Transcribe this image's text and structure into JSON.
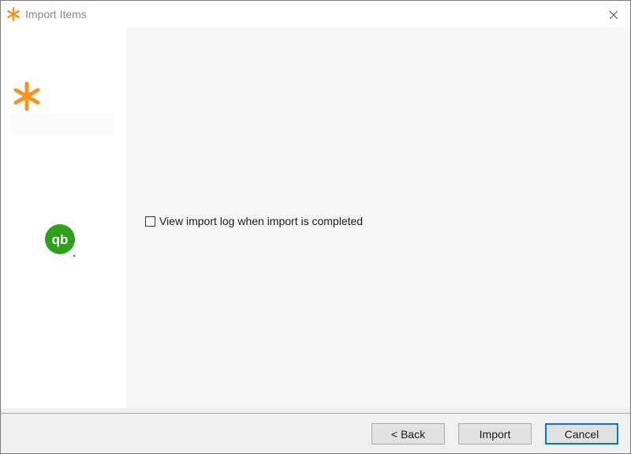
{
  "window": {
    "title": "Import Items",
    "icon": "asterisk-logo-icon",
    "close_icon": "close-icon"
  },
  "sidebar": {
    "brand_icon": "orange-asterisk-logo-icon",
    "integration_icon": "quickbooks-logo-icon",
    "integration_icon_text": "qb"
  },
  "main": {
    "checkbox": {
      "label": "View import log when import is completed",
      "checked": false
    }
  },
  "footer": {
    "back_label": "< Back",
    "import_label": "Import",
    "cancel_label": "Cancel"
  },
  "colors": {
    "brand_orange": "#f7941d",
    "quickbooks_green": "#2ca01c",
    "content_bg": "#f7f6f4",
    "focus_blue": "#0078d7"
  }
}
